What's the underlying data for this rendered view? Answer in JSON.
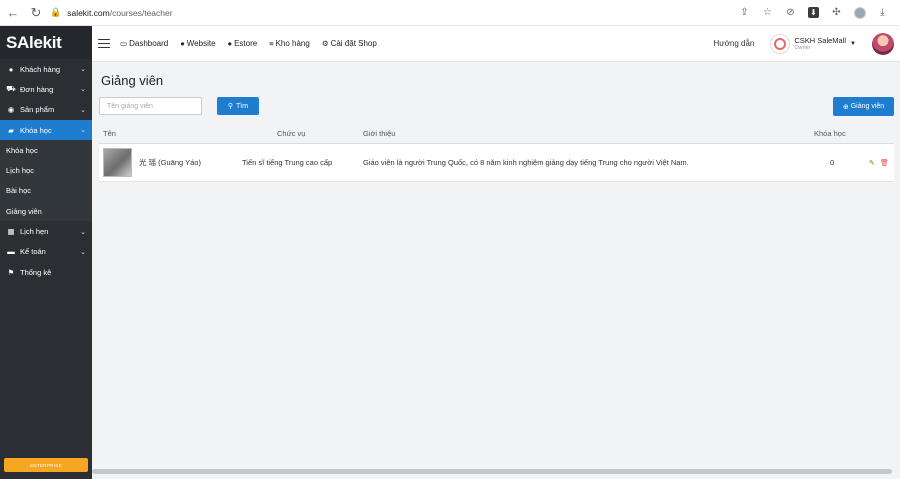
{
  "browser": {
    "url_host": "salekit.com",
    "url_path": "/courses/teacher"
  },
  "sidebar": {
    "logo": "SAlekit",
    "items": [
      {
        "label": "Khách hàng",
        "icon": "user-icon",
        "glyph": "●",
        "chevron": true
      },
      {
        "label": "Đơn hàng",
        "icon": "cart-icon",
        "glyph": "⛟",
        "chevron": true
      },
      {
        "label": "Sản phẩm",
        "icon": "product-icon",
        "glyph": "◉",
        "chevron": true
      },
      {
        "label": "Khóa học",
        "icon": "book-icon",
        "glyph": "▰",
        "chevron": true,
        "active": true
      }
    ],
    "sub_items": [
      {
        "label": "Khóa học"
      },
      {
        "label": "Lịch học"
      },
      {
        "label": "Bài học"
      },
      {
        "label": "Giảng viên"
      }
    ],
    "items_after": [
      {
        "label": "Lịch hẹn",
        "icon": "calendar-icon",
        "glyph": "▦",
        "chevron": true
      },
      {
        "label": "Kế toán",
        "icon": "accounting-icon",
        "glyph": "▬",
        "chevron": true
      },
      {
        "label": "Thống kê",
        "icon": "flag-icon",
        "glyph": "⚑",
        "chevron": false
      }
    ],
    "upgrade_label": "ENTERPRISE"
  },
  "topnav": {
    "items": [
      {
        "label": "Dashboard",
        "icon": "monitor-icon",
        "glyph": "▭"
      },
      {
        "label": "Website",
        "icon": "globe-icon",
        "glyph": "●"
      },
      {
        "label": "Estore",
        "icon": "globe-icon",
        "glyph": "●"
      },
      {
        "label": "Kho hàng",
        "icon": "database-icon",
        "glyph": "≡"
      },
      {
        "label": "Cài đặt Shop",
        "icon": "gear-icon",
        "glyph": "⚙"
      }
    ],
    "guide": "Hướng dẫn",
    "user_name": "CSKH SaleMall",
    "user_role": "Owner"
  },
  "main": {
    "title": "Giảng viên",
    "search_placeholder": "Tên giảng viên",
    "search_button": "Tìm",
    "add_button": "Giảng viên",
    "columns": [
      "Tên",
      "Chức vụ",
      "Giới thiệu",
      "Khóa học"
    ],
    "rows": [
      {
        "name": "光 瑶 (Guāng Yáo)",
        "position": "Tiến sĩ tiếng Trung cao cấp",
        "intro": "Giáo viên là người Trung Quốc, có 8 năm kinh nghiệm giảng dạy tiếng Trung cho người Việt Nam.",
        "courses": "0"
      }
    ]
  },
  "colors": {
    "sidebar_bg": "#2b2f33",
    "accent": "#1f7dd0",
    "upgrade": "#f5a623",
    "edit_icon": "#6a8f2a",
    "delete_icon": "#d9534f"
  }
}
